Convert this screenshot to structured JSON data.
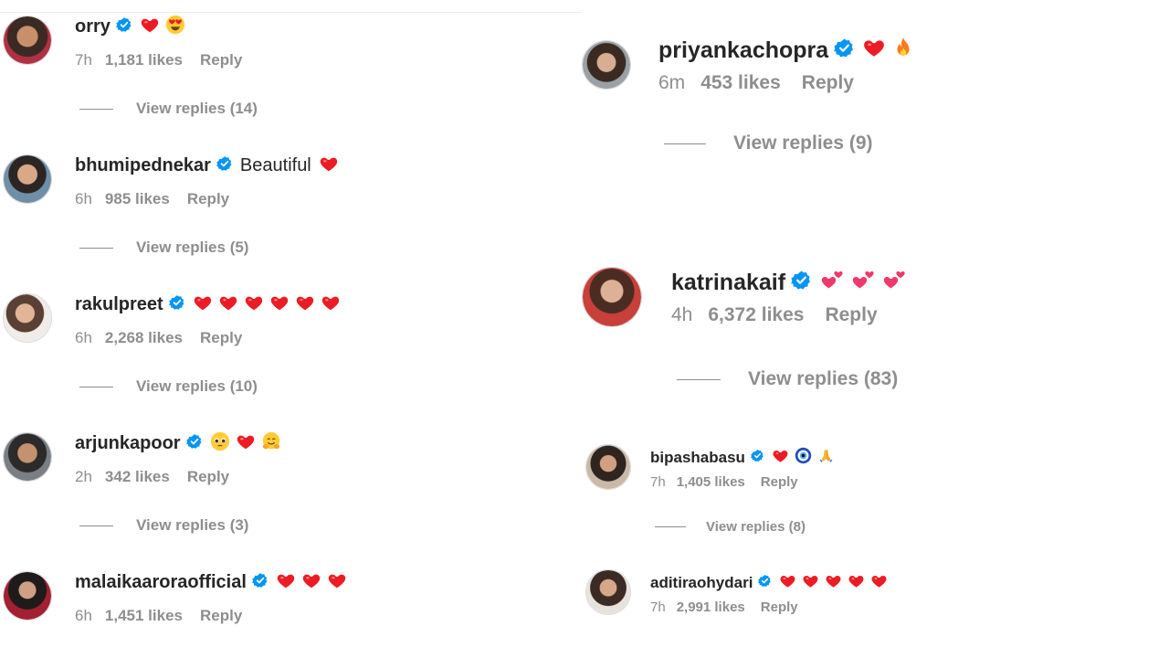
{
  "left_panel": {
    "comments": [
      {
        "username": "orry",
        "text": "",
        "emojis": [
          "heart",
          "heart-eyes"
        ],
        "time": "7h",
        "likes": "1,181 likes",
        "reply": "Reply",
        "view_replies": "View replies (14)"
      },
      {
        "username": "bhumipednekar",
        "text": "Beautiful",
        "emojis": [
          "heart"
        ],
        "time": "6h",
        "likes": "985 likes",
        "reply": "Reply",
        "view_replies": "View replies (5)"
      },
      {
        "username": "rakulpreet",
        "text": "",
        "emojis": [
          "heart",
          "heart",
          "heart",
          "heart",
          "heart",
          "heart"
        ],
        "time": "6h",
        "likes": "2,268 likes",
        "reply": "Reply",
        "view_replies": "View replies (10)"
      },
      {
        "username": "arjunkapoor",
        "text": "",
        "emojis": [
          "pleading-face",
          "heart",
          "hugging-face"
        ],
        "time": "2h",
        "likes": "342 likes",
        "reply": "Reply",
        "view_replies": "View replies (3)"
      },
      {
        "username": "malaikaaroraofficial",
        "text": "",
        "emojis": [
          "heart",
          "heart",
          "heart"
        ],
        "time": "6h",
        "likes": "1,451 likes",
        "reply": "Reply",
        "view_replies": ""
      }
    ]
  },
  "right_panel": {
    "comments": [
      {
        "username": "priyankachopra",
        "text": "",
        "emojis": [
          "heart",
          "fire"
        ],
        "time": "6m",
        "likes": "453 likes",
        "reply": "Reply",
        "view_replies": "View replies (9)"
      },
      {
        "username": "katrinakaif",
        "text": "",
        "emojis": [
          "two-hearts",
          "two-hearts",
          "two-hearts"
        ],
        "time": "4h",
        "likes": "6,372 likes",
        "reply": "Reply",
        "view_replies": "View replies (83)"
      },
      {
        "username": "bipashabasu",
        "text": "",
        "emojis": [
          "heart",
          "nazar-amulet",
          "folded-hands"
        ],
        "time": "7h",
        "likes": "1,405 likes",
        "reply": "Reply",
        "view_replies": "View replies (8)"
      },
      {
        "username": "aditiraohydari",
        "text": "",
        "emojis": [
          "heart",
          "heart",
          "heart",
          "heart",
          "heart"
        ],
        "time": "7h",
        "likes": "2,991 likes",
        "reply": "Reply",
        "view_replies": ""
      }
    ]
  },
  "colors": {
    "text": "#262626",
    "muted": "#8e8e8e",
    "verified": "#0095f6",
    "heart": "#ed1c24"
  }
}
